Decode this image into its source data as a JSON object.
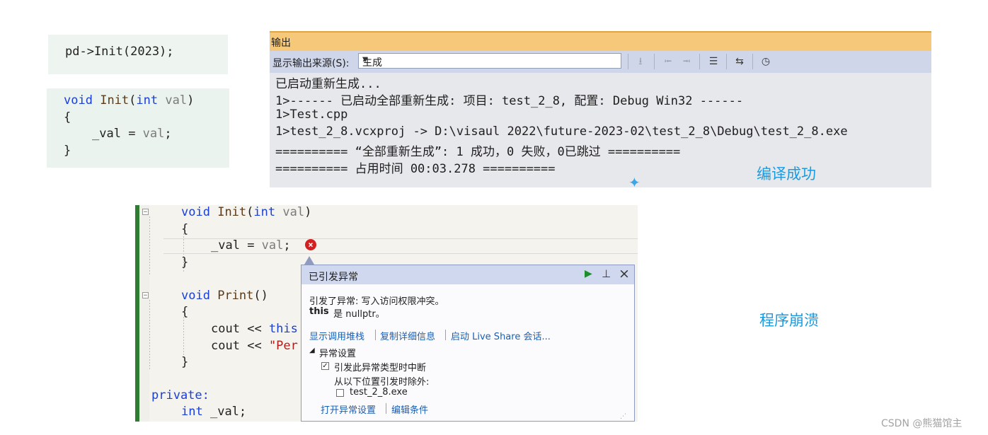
{
  "snippet1": {
    "code": "pd->Init(2023);"
  },
  "snippet2": {
    "kw_void": "void",
    "fn_name": "Init",
    "kw_int": "int",
    "param": "val",
    "brace_open": "{",
    "lhs": "_val",
    "rhs": "val",
    "brace_close": "}"
  },
  "output": {
    "title": "输出",
    "source_label": "显示输出来源(S):",
    "source_value": "生成",
    "lines": [
      "已启动重新生成...",
      "1>------ 已启动全部重新生成: 项目: test_2_8, 配置: Debug Win32 ------",
      "1>Test.cpp",
      "1>test_2_8.vcxproj -> D:\\visaul 2022\\future-2023-02\\test_2_8\\Debug\\test_2_8.exe",
      "========== “全部重新生成”: 1 成功，0 失败，0已跳过 ==========",
      "========== 占用时间 00:03.278 =========="
    ]
  },
  "annotation_success": "编译成功",
  "editor": {
    "kw_void": "void",
    "fn_init": "Init",
    "kw_int": "int",
    "param": "val",
    "lhs": "_val",
    "rhs": "val",
    "fn_print": "Print",
    "cout": "cout",
    "shl": "<<",
    "this_kw": "this",
    "str_part": "\"Per",
    "private_kw": "private:",
    "member_type": "int",
    "member_name": "_val;"
  },
  "exception": {
    "title": "已引发异常",
    "message": "引发了异常: 写入访问权限冲突。",
    "detail_bold": "this",
    "detail_rest": " 是 nullptr。",
    "link_callstack": "显示调用堆栈",
    "link_copy": "复制详细信息",
    "link_liveshare": "启动 Live Share 会话...",
    "section": "异常设置",
    "checkbox_break": "引发此异常类型时中断",
    "checkbox_break_checked": true,
    "except_label": "从以下位置引发时除外:",
    "checkbox_exe": "test_2_8.exe",
    "checkbox_exe_checked": false,
    "link_open_settings": "打开异常设置",
    "link_edit_conditions": "编辑条件"
  },
  "annotation_crash": "程序崩溃",
  "watermark": "CSDN @熊猫馆主"
}
